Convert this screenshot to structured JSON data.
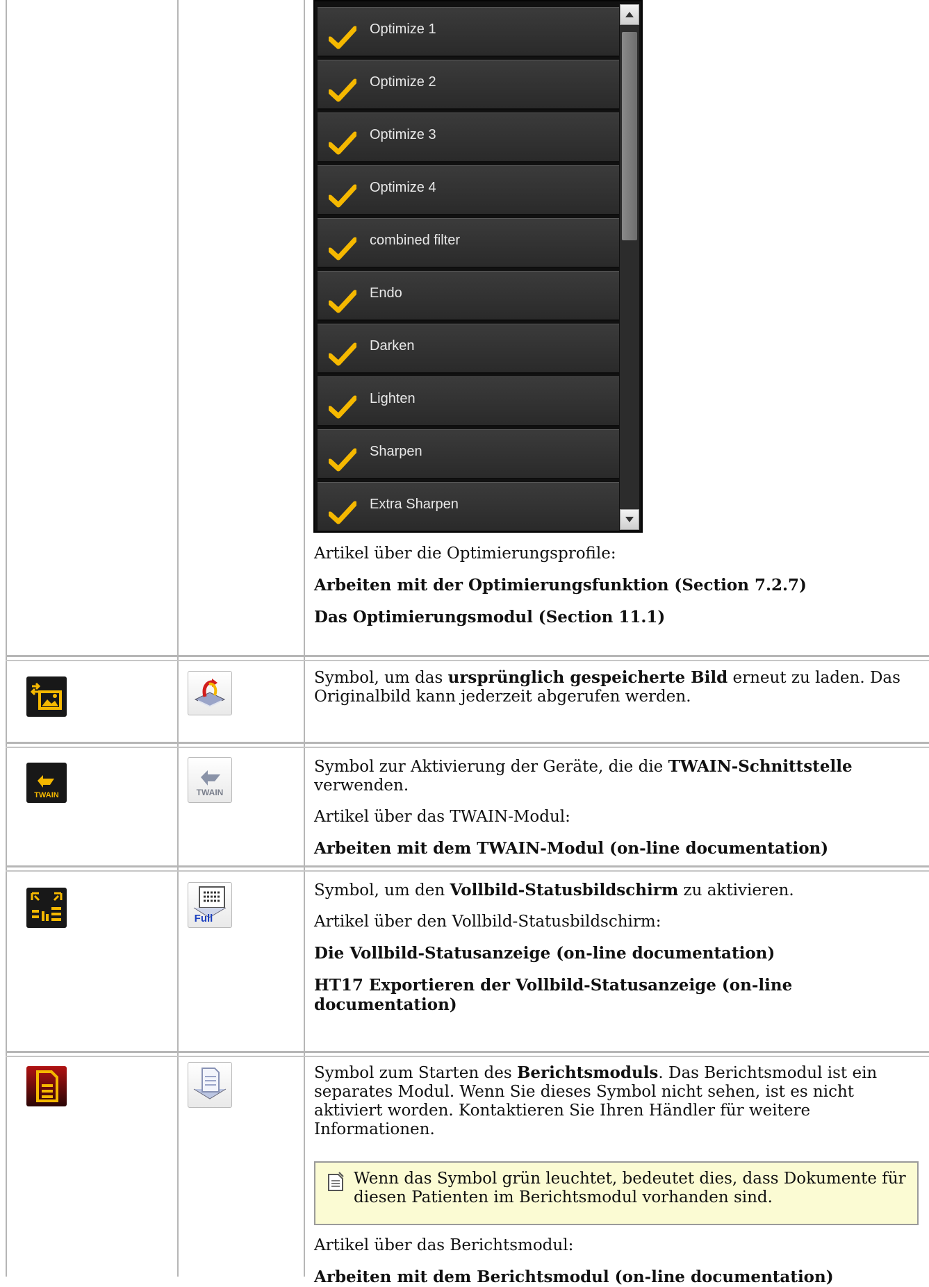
{
  "optimize_dropdown": {
    "items": [
      {
        "label": "Optimize 1"
      },
      {
        "label": "Optimize 2"
      },
      {
        "label": "Optimize 3"
      },
      {
        "label": "Optimize 4"
      },
      {
        "label": "combined filter"
      },
      {
        "label": "Endo"
      },
      {
        "label": "Darken"
      },
      {
        "label": "Lighten"
      },
      {
        "label": "Sharpen"
      },
      {
        "label": "Extra Sharpen"
      }
    ]
  },
  "rows": {
    "optimize": {
      "intro": "Artikel über die Optimierungsprofile:",
      "link1": "Arbeiten mit der Optimierungsfunktion (Section 7.2.7)",
      "link2": "Das Optimierungsmodul (Section 11.1)"
    },
    "reload": {
      "text_before": "Symbol, um das ",
      "bold": "ursprünglich gespeicherte Bild",
      "text_after": " erneut zu laden. Das Originalbild kann jederzeit abgerufen werden.",
      "icon_dark_label": "",
      "icon_light_label": ""
    },
    "twain": {
      "text_before": "Symbol zur Aktivierung der Geräte, die die ",
      "bold": "TWAIN-Schnittstelle",
      "text_after": " verwenden.",
      "intro": "Artikel über das TWAIN-Modul:",
      "link1": "Arbeiten mit dem TWAIN-Modul (on-line documentation)",
      "icon_dark_label": "TWAIN",
      "icon_light_label": "TWAIN"
    },
    "fullscreen": {
      "text_before": "Symbol, um den ",
      "bold": "Vollbild-Statusbildschirm",
      "text_after": " zu aktivieren.",
      "intro": "Artikel über den Vollbild-Statusbildschirm:",
      "link1": "Die Vollbild-Statusanzeige (on-line documentation)",
      "link2": "HT17 Exportieren der Vollbild-Statusanzeige (on-line documentation)",
      "icon_light_label": "Full"
    },
    "report": {
      "text_before": "Symbol zum Starten des ",
      "bold": "Berichtsmoduls",
      "text_after": ". Das Berichtsmodul ist ein separates Modul. Wenn Sie dieses Symbol nicht sehen, ist es nicht aktiviert worden. Kontaktieren Sie Ihren Händler für weitere Informationen.",
      "note": "Wenn das Symbol grün leuchtet, bedeutet dies, dass Dokumente für diesen Patienten im Berichtsmodul vorhanden sind.",
      "intro": "Artikel über das Berichtsmodul:",
      "link1": "Arbeiten mit dem Berichtsmodul (on-line documentation)"
    }
  },
  "colors": {
    "accent_check": "#f5b800",
    "note_bg": "#fbfbd3",
    "grid_line": "#b6b6b6"
  }
}
